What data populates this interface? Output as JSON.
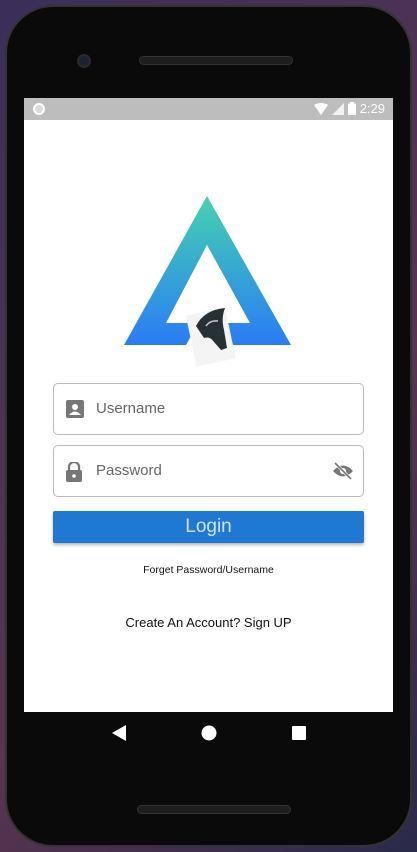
{
  "status_bar": {
    "time": "2:29",
    "icons": [
      "wifi-icon",
      "signal-icon",
      "battery-icon"
    ]
  },
  "login_form": {
    "username": {
      "placeholder": "Username",
      "value": "",
      "icon": "account-box-icon"
    },
    "password": {
      "placeholder": "Password",
      "value": "",
      "icon": "lock-icon",
      "toggle_icon": "eye-off-icon"
    },
    "login_label": "Login",
    "forget_label": "Forget Password/Username",
    "create_label": "Create An Account? Sign UP"
  },
  "colors": {
    "accent": "#1f78d1",
    "logo_top": "#44d2b0",
    "logo_bottom": "#2a7cf5"
  },
  "nav_bar": {
    "icons": [
      "back-icon",
      "home-icon",
      "recents-icon"
    ]
  }
}
